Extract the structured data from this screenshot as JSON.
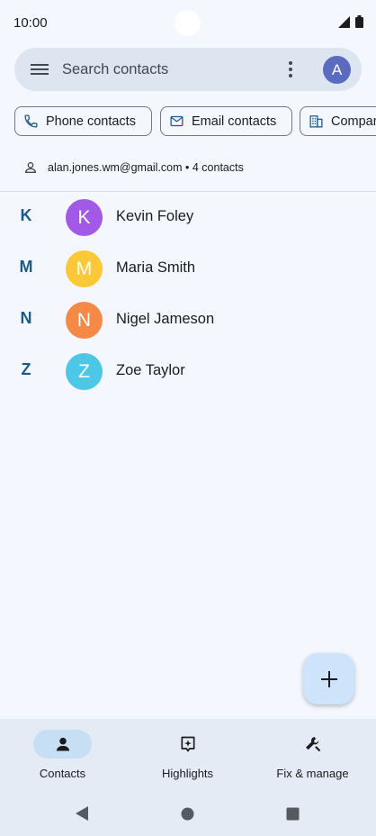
{
  "status_bar": {
    "time": "10:00"
  },
  "search": {
    "placeholder": "Search contacts",
    "avatar_letter": "A"
  },
  "chips": [
    {
      "label": "Phone contacts",
      "icon": "phone-icon"
    },
    {
      "label": "Email contacts",
      "icon": "mail-icon"
    },
    {
      "label": "Company",
      "icon": "building-icon"
    }
  ],
  "account": {
    "text": "alan.jones.wm@gmail.com • 4 contacts"
  },
  "contacts": [
    {
      "section": "K",
      "initial": "K",
      "name": "Kevin Foley",
      "color": "#a259e6"
    },
    {
      "section": "M",
      "initial": "M",
      "name": "Maria Smith",
      "color": "#fbc837"
    },
    {
      "section": "N",
      "initial": "N",
      "name": "Nigel Jameson",
      "color": "#f58a46"
    },
    {
      "section": "Z",
      "initial": "Z",
      "name": "Zoe Taylor",
      "color": "#4cc7e6"
    }
  ],
  "fab": {
    "icon": "plus-icon"
  },
  "bottom_nav": [
    {
      "label": "Contacts",
      "icon": "person-icon",
      "active": true
    },
    {
      "label": "Highlights",
      "icon": "highlights-icon",
      "active": false
    },
    {
      "label": "Fix & manage",
      "icon": "wrench-icon",
      "active": false
    }
  ],
  "colors": {
    "accent": "#1e5a86",
    "search_bg": "#dde5f0",
    "fab_bg": "#cde4fb",
    "nav_active": "#c7dff4"
  }
}
